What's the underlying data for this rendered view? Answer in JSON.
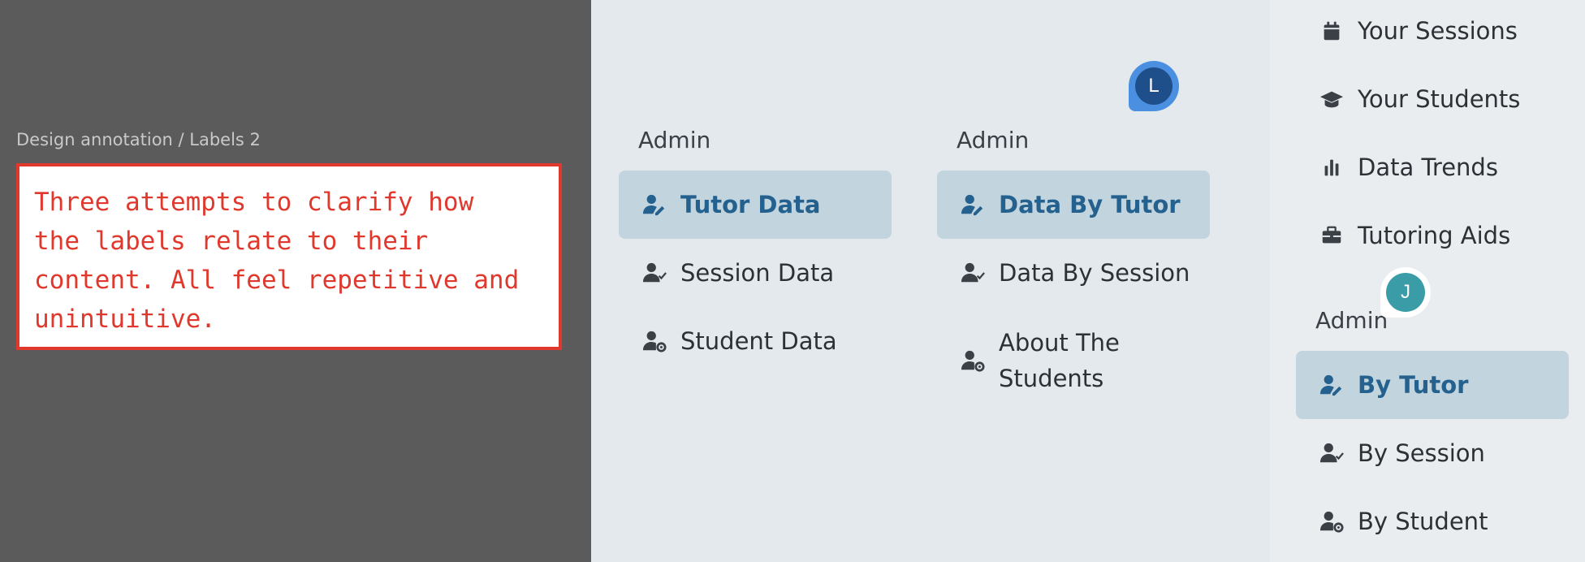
{
  "canvas": {
    "frame_label": "Design annotation / Labels 2",
    "annotation_text": "Three attempts to clarify how\nthe labels relate to their\ncontent. All feel repetitive and\nunintuitive."
  },
  "variant_a": {
    "heading": "Admin",
    "items": [
      {
        "label": "Tutor Data",
        "icon": "user-pen-icon",
        "active": true
      },
      {
        "label": "Session Data",
        "icon": "user-check-icon",
        "active": false
      },
      {
        "label": "Student Data",
        "icon": "user-gear-icon",
        "active": false
      }
    ]
  },
  "variant_b": {
    "heading": "Admin",
    "items": [
      {
        "label": "Data By Tutor",
        "icon": "user-pen-icon",
        "active": true
      },
      {
        "label": "Data By Session",
        "icon": "user-check-icon",
        "active": false
      },
      {
        "label": "About The Students",
        "icon": "user-gear-icon",
        "active": false
      }
    ]
  },
  "variant_c": {
    "top_items": [
      {
        "label": "Your Sessions",
        "icon": "calendar-icon"
      },
      {
        "label": "Your Students",
        "icon": "graduation-cap-icon"
      },
      {
        "label": "Data Trends",
        "icon": "bar-chart-icon"
      },
      {
        "label": "Tutoring Aids",
        "icon": "toolbox-icon"
      }
    ],
    "heading": "Admin",
    "items": [
      {
        "label": "By Tutor",
        "icon": "user-pen-icon",
        "active": true
      },
      {
        "label": "By Session",
        "icon": "user-check-icon",
        "active": false
      },
      {
        "label": "By Student",
        "icon": "user-gear-icon",
        "active": false
      }
    ]
  },
  "collaborators": [
    {
      "initial": "L",
      "color": "#1f4f8a"
    },
    {
      "initial": "J",
      "color": "#3a9ca6"
    }
  ],
  "colors": {
    "accent": "#24618e",
    "active_bg": "#c2d4de",
    "annotation_red": "#e0382c"
  }
}
